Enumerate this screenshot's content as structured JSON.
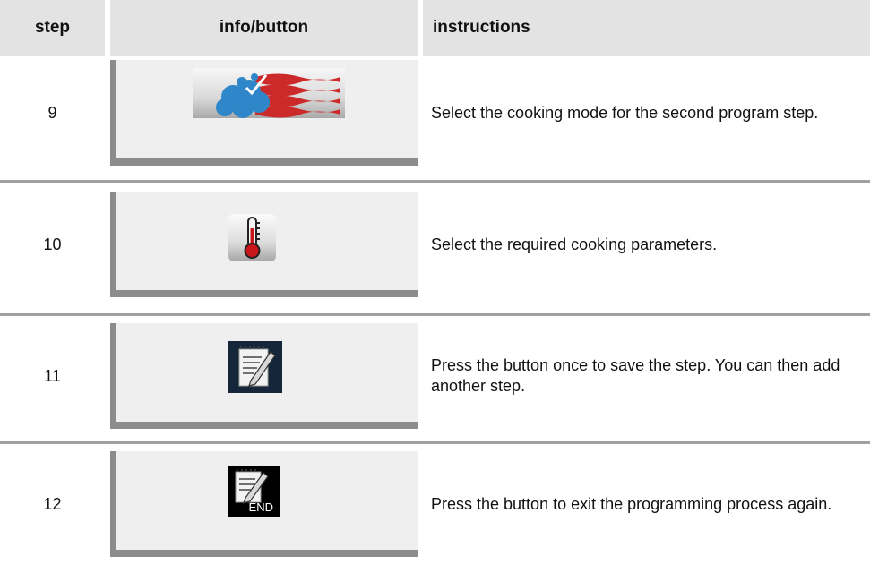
{
  "header": {
    "step": "step",
    "info": "info/button",
    "instructions": "instructions"
  },
  "rows": [
    {
      "step": "9",
      "icon": "steam-convection-mode-icon",
      "instruction": "Select the cooking mode for the second program step."
    },
    {
      "step": "10",
      "icon": "thermometer-icon",
      "instruction": "Select the required cooking parameters."
    },
    {
      "step": "11",
      "icon": "notepad-save-icon",
      "instruction": "Press the button once to save the step. You can then add another step."
    },
    {
      "step": "12",
      "icon": "notepad-end-icon",
      "end_label": "END",
      "instruction": "Press the button to exit the programming process again."
    }
  ],
  "colors": {
    "header_bg": "#e3e3e3",
    "panel_bg": "#efefef",
    "panel_shadow": "#8c8c8c",
    "steam_blue": "#2f86c8",
    "flag_red": "#cc2a2a",
    "thermo_red": "#c8161b",
    "save_icon_bg": "#16263a"
  }
}
